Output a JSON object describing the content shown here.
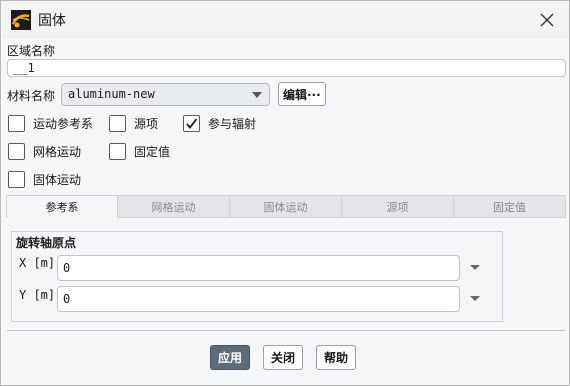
{
  "window": {
    "title": "固体"
  },
  "zone_name": {
    "label": "区域名称",
    "value": "__1"
  },
  "material": {
    "label": "材料名称",
    "selected": "aluminum-new",
    "edit_label": "编辑···"
  },
  "options": [
    {
      "label": "运动参考系",
      "checked": false
    },
    {
      "label": "源项",
      "checked": false
    },
    {
      "label": "参与辐射",
      "checked": true
    },
    {
      "label": "网格运动",
      "checked": false
    },
    {
      "label": "固定值",
      "checked": false
    },
    {
      "label": "固体运动",
      "checked": false
    }
  ],
  "tabs": [
    {
      "label": "参考系",
      "active": true
    },
    {
      "label": "网格运动",
      "active": false
    },
    {
      "label": "固体运动",
      "active": false
    },
    {
      "label": "源项",
      "active": false
    },
    {
      "label": "固定值",
      "active": false
    }
  ],
  "rotation_origin": {
    "title": "旋转轴原点",
    "x": {
      "label": "X [m]",
      "value": "0"
    },
    "y": {
      "label": "Y [m]",
      "value": "0"
    }
  },
  "footer": {
    "apply": "应用",
    "close": "关闭",
    "help": "帮助"
  },
  "colors": {
    "primary_button": "#5f6b76",
    "tab_inactive": "#e3e5e7"
  }
}
